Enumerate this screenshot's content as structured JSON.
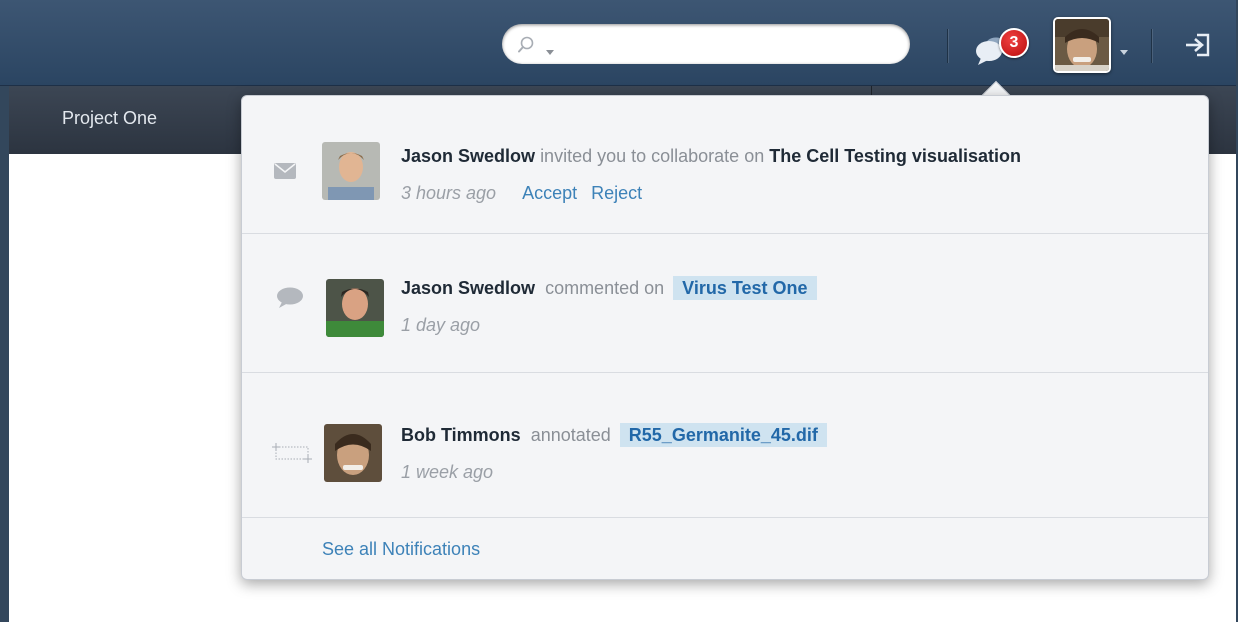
{
  "header": {
    "search": {
      "value": "",
      "placeholder": ""
    },
    "notification_count": "3"
  },
  "subnav": {
    "project_title": "Project One"
  },
  "notifications": [
    {
      "actor": "Jason Swedlow",
      "verb": "invited you to collaborate on",
      "target": "The Cell Testing visualisation",
      "time": "3 hours ago",
      "accept_label": "Accept",
      "reject_label": "Reject",
      "type_icon": "envelope-icon"
    },
    {
      "actor": "Jason Swedlow",
      "verb": "commented on",
      "target": "Virus Test One",
      "time": "1 day ago",
      "type_icon": "speech-bubble-icon"
    },
    {
      "actor": "Bob Timmons",
      "verb": "annotated",
      "target": "R55_Germanite_45.dif",
      "time": "1 week ago",
      "type_icon": "annotation-region-icon"
    }
  ],
  "see_all_label": "See all Notifications",
  "colors": {
    "topbar": "#34506e",
    "subnav": "#343d4a",
    "badge": "#d62020",
    "link": "#3d82b8",
    "tag_background": "#cfe3f0",
    "tag_text": "#2268a8"
  }
}
